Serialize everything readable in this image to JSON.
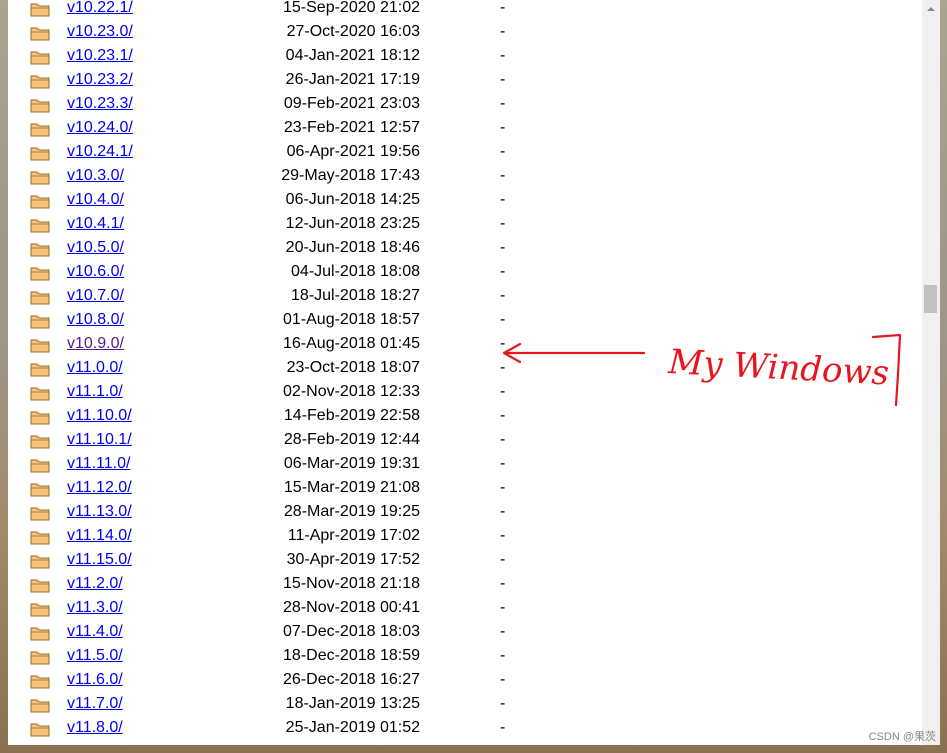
{
  "directory": {
    "entries": [
      {
        "name": "v10.22.1/",
        "date": "15-Sep-2020 21:02",
        "size": "-"
      },
      {
        "name": "v10.23.0/",
        "date": "27-Oct-2020 16:03",
        "size": "-"
      },
      {
        "name": "v10.23.1/",
        "date": "04-Jan-2021 18:12",
        "size": "-"
      },
      {
        "name": "v10.23.2/",
        "date": "26-Jan-2021 17:19",
        "size": "-"
      },
      {
        "name": "v10.23.3/",
        "date": "09-Feb-2021 23:03",
        "size": "-"
      },
      {
        "name": "v10.24.0/",
        "date": "23-Feb-2021 12:57",
        "size": "-"
      },
      {
        "name": "v10.24.1/",
        "date": "06-Apr-2021 19:56",
        "size": "-"
      },
      {
        "name": "v10.3.0/",
        "date": "29-May-2018 17:43",
        "size": "-"
      },
      {
        "name": "v10.4.0/",
        "date": "06-Jun-2018 14:25",
        "size": "-"
      },
      {
        "name": "v10.4.1/",
        "date": "12-Jun-2018 23:25",
        "size": "-"
      },
      {
        "name": "v10.5.0/",
        "date": "20-Jun-2018 18:46",
        "size": "-"
      },
      {
        "name": "v10.6.0/",
        "date": "04-Jul-2018 18:08",
        "size": "-"
      },
      {
        "name": "v10.7.0/",
        "date": "18-Jul-2018 18:27",
        "size": "-"
      },
      {
        "name": "v10.8.0/",
        "date": "01-Aug-2018 18:57",
        "size": "-"
      },
      {
        "name": "v10.9.0/",
        "date": "16-Aug-2018 01:45",
        "size": "-",
        "visited": true
      },
      {
        "name": "v11.0.0/",
        "date": "23-Oct-2018 18:07",
        "size": "-"
      },
      {
        "name": "v11.1.0/",
        "date": "02-Nov-2018 12:33",
        "size": "-"
      },
      {
        "name": "v11.10.0/",
        "date": "14-Feb-2019 22:58",
        "size": "-"
      },
      {
        "name": "v11.10.1/",
        "date": "28-Feb-2019 12:44",
        "size": "-"
      },
      {
        "name": "v11.11.0/",
        "date": "06-Mar-2019 19:31",
        "size": "-"
      },
      {
        "name": "v11.12.0/",
        "date": "15-Mar-2019 21:08",
        "size": "-"
      },
      {
        "name": "v11.13.0/",
        "date": "28-Mar-2019 19:25",
        "size": "-"
      },
      {
        "name": "v11.14.0/",
        "date": "11-Apr-2019 17:02",
        "size": "-"
      },
      {
        "name": "v11.15.0/",
        "date": "30-Apr-2019 17:52",
        "size": "-"
      },
      {
        "name": "v11.2.0/",
        "date": "15-Nov-2018 21:18",
        "size": "-"
      },
      {
        "name": "v11.3.0/",
        "date": "28-Nov-2018 00:41",
        "size": "-"
      },
      {
        "name": "v11.4.0/",
        "date": "07-Dec-2018 18:03",
        "size": "-"
      },
      {
        "name": "v11.5.0/",
        "date": "18-Dec-2018 18:59",
        "size": "-"
      },
      {
        "name": "v11.6.0/",
        "date": "26-Dec-2018 16:27",
        "size": "-"
      },
      {
        "name": "v11.7.0/",
        "date": "18-Jan-2019 13:25",
        "size": "-"
      },
      {
        "name": "v11.8.0/",
        "date": "25-Jan-2019 01:52",
        "size": "-"
      }
    ]
  },
  "annotation": {
    "text": "My Windows",
    "color": "#e8141e"
  },
  "watermark": "CSDN @果茨",
  "colors": {
    "link": "#0000ee",
    "visited_link": "#551a8b",
    "folder_fill": "#f5c27a",
    "folder_stroke": "#9a6a2a"
  },
  "icons": {
    "entry_icon": "folder-icon"
  }
}
